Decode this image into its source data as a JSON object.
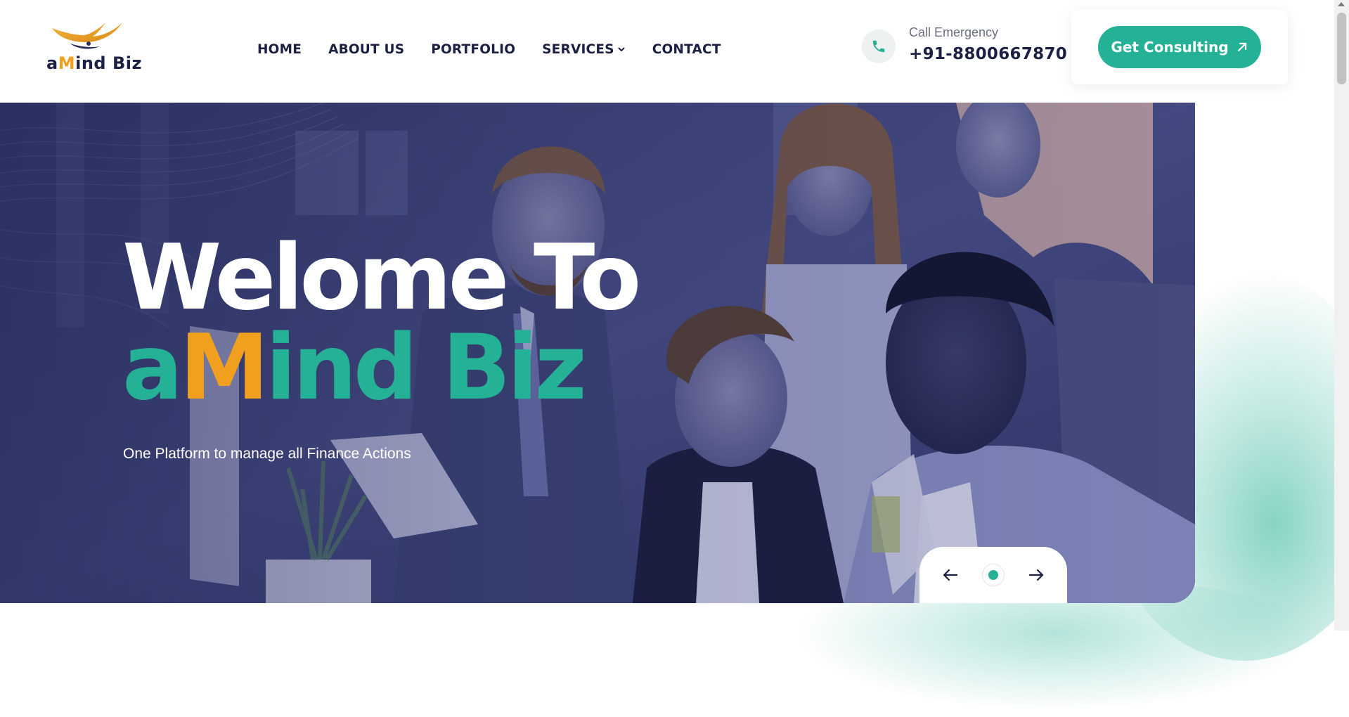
{
  "brand": {
    "logo_text_a": "a",
    "logo_text_m": "M",
    "logo_text_rest": "ind Biz",
    "primary_color": "#25b196",
    "accent_color": "#f0a01e",
    "dark_color": "#1c2143"
  },
  "nav": {
    "items": [
      {
        "label": "HOME"
      },
      {
        "label": "ABOUT US"
      },
      {
        "label": "PORTFOLIO"
      },
      {
        "label": "SERVICES",
        "has_dropdown": true
      },
      {
        "label": "CONTACT"
      }
    ]
  },
  "contact": {
    "icon": "phone-icon",
    "label": "Call Emergency",
    "number": "+91-8800667870"
  },
  "cta": {
    "label": "Get Consulting",
    "icon": "arrow-up-right-icon"
  },
  "hero": {
    "title": "Welome To",
    "brand_a": "a",
    "brand_m": "M",
    "brand_rest": "ind Biz",
    "subtitle": "One Platform to manage all Finance Actions"
  },
  "slider": {
    "prev_icon": "arrow-left-icon",
    "next_icon": "arrow-right-icon",
    "active_slide": 1,
    "total_slides": 1
  }
}
